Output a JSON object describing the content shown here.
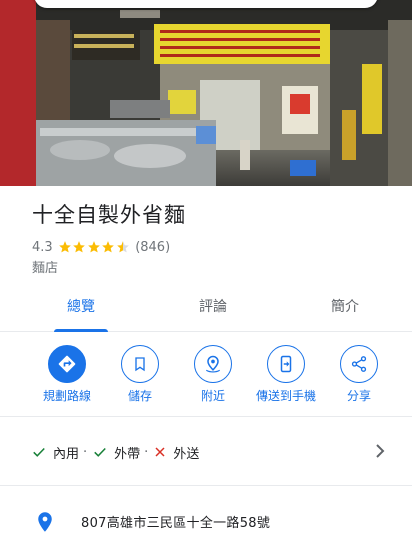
{
  "place": {
    "title": "十全自製外省麵",
    "rating": "4.3",
    "stars": 4.3,
    "review_count": "(846)",
    "category": "麵店"
  },
  "tabs": [
    {
      "label": "總覽",
      "active": true
    },
    {
      "label": "評論",
      "active": false
    },
    {
      "label": "簡介",
      "active": false
    }
  ],
  "actions": {
    "directions": "規劃路線",
    "save": "儲存",
    "nearby": "附近",
    "send_to_phone": "傳送到手機",
    "share": "分享"
  },
  "services": {
    "dine_in": "內用",
    "takeout": "外帶",
    "delivery": "外送",
    "separator": "·"
  },
  "address": "807高雄市三民區十全一路58號",
  "colors": {
    "accent": "#1a73e8",
    "star": "#fbbc04",
    "check": "#188038",
    "cross": "#d93025",
    "secondary_text": "#70757a"
  },
  "icons": {
    "directions": "turn-right-arrow-icon",
    "save": "bookmark-icon",
    "nearby": "nearby-pin-icon",
    "send_to_phone": "send-to-phone-icon",
    "share": "share-icon",
    "address": "location-pin-icon"
  }
}
